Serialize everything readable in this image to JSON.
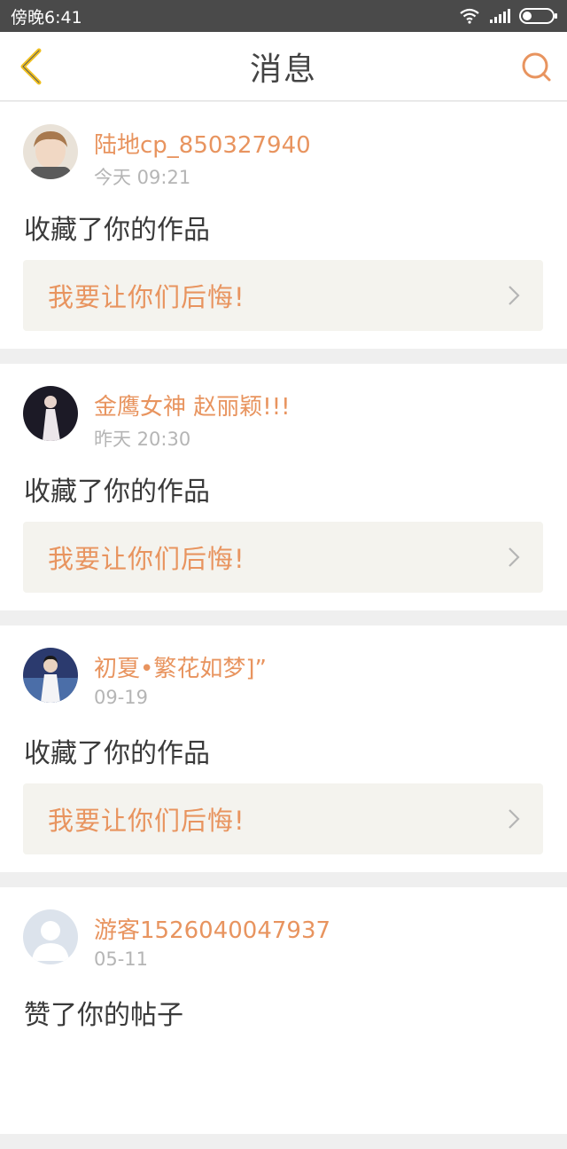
{
  "status": {
    "time": "傍晚6:41",
    "icons": [
      "wifi-icon",
      "signal-icon",
      "battery-icon"
    ]
  },
  "nav": {
    "title": "消息",
    "back_icon": "chevron-left-icon",
    "search_icon": "search-icon"
  },
  "colors": {
    "accent": "#e8945f",
    "back_icon": "#f0c020",
    "card_bg": "#f4f3ee"
  },
  "messages": [
    {
      "username": "陆地cp_850327940",
      "time": "今天 09:21",
      "action": "收藏了你的作品",
      "work_title": "我要让你们后悔!"
    },
    {
      "username": "金鹰女神 赵丽颖!!!",
      "time": "昨天 20:30",
      "action": "收藏了你的作品",
      "work_title": "我要让你们后悔!"
    },
    {
      "username": "初夏•繁花如梦]”",
      "time": "09-19",
      "action": "收藏了你的作品",
      "work_title": "我要让你们后悔!"
    },
    {
      "username": "游客1526040047937",
      "time": "05-11",
      "action": "赞了你的帖子"
    }
  ]
}
